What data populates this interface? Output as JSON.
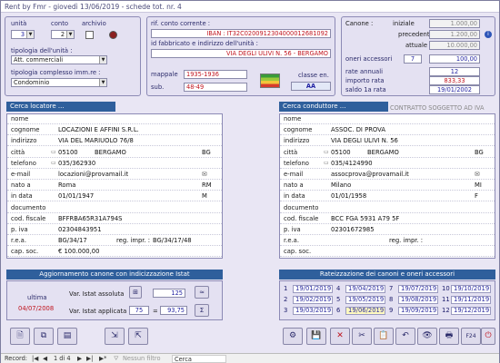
{
  "window": {
    "title": "Rent by Fmr - giovedì 13/06/2019 - schede tot. nr. 4"
  },
  "unit": {
    "unita_label": "unità",
    "conto_label": "conto",
    "archivio_label": "archivio",
    "unita_value": "3",
    "conto_value": "2",
    "tipologia_label": "tipologia dell'unità :",
    "tipologia_value": "Att. commerciali",
    "complesso_label": "tipologia complesso imm.re :",
    "complesso_value": "Condominio"
  },
  "conto": {
    "rif_label": "rif. conto corrente :",
    "iban": "IBAN : IT32C0200912304000012681092",
    "indirizzo_label": "id fabbricato e indirizzo dell'unità :",
    "indirizzo": "VIA DEGLI ULIVI N. 56 - BERGAMO",
    "mappale_label": "mappale",
    "mappale": "1935-1936",
    "sub_label": "sub.",
    "sub": "48-49",
    "classe_label": "classe en.",
    "classe": "AA"
  },
  "canone": {
    "canone_label": "Canone :",
    "iniziale_label": "iniziale",
    "iniziale": "1.000,00",
    "precedente_label": "precedente",
    "precedente": "1.200,00",
    "attuale_label": "attuale",
    "attuale": "10.000,00",
    "oneri_label": "oneri accessori",
    "oneri_n": "7",
    "oneri": "100,00",
    "rate_label": "rate annuali",
    "rate": "12",
    "importo_label": "importo rata",
    "importo": "833,33",
    "saldo_label": "saldo 1a rata",
    "saldo": "19/01/2002",
    "contratto": "CONTRATTO SOGGETTO AD IVA"
  },
  "locatore": {
    "header": "Cerca locatore ...",
    "rows": [
      {
        "k": "nome",
        "v": ""
      },
      {
        "k": "cognome",
        "v": "LOCAZIONI E AFFINI S.R.L."
      },
      {
        "k": "indirizzo",
        "v": "VIA DEL MARIUOLO 76/8"
      },
      {
        "k": "città",
        "v": "05100",
        "v2": "BERGAMO",
        "v3": "BG"
      },
      {
        "k": "telefono",
        "v": "035/362930"
      },
      {
        "k": "e-mail",
        "v": "locazioni@provamail.it"
      },
      {
        "k": "nato a",
        "v": "Roma",
        "v3": "RM"
      },
      {
        "k": "in data",
        "v": "01/01/1947",
        "v3": "M"
      },
      {
        "k": "documento",
        "v": ""
      },
      {
        "k": "cod. fiscale",
        "v": "BFFRBA65R31A794S"
      },
      {
        "k": "p. iva",
        "v": "02304843951"
      },
      {
        "k": "r.e.a.",
        "v": "BG/34/17",
        "v2k": "reg. impr. :",
        "v2": "BG/34/17/48"
      },
      {
        "k": "cap. soc.",
        "v": "€ 100.000,00"
      }
    ]
  },
  "conduttore": {
    "header": "Cerca conduttore ...",
    "rows": [
      {
        "k": "nome",
        "v": ""
      },
      {
        "k": "cognome",
        "v": "ASSOC. DI PROVA"
      },
      {
        "k": "indirizzo",
        "v": "VIA DEGLI ULIVI N. 56"
      },
      {
        "k": "città",
        "v": "05100",
        "v2": "BERGAMO",
        "v3": "BG"
      },
      {
        "k": "telefono",
        "v": "035/4124990"
      },
      {
        "k": "e-mail",
        "v": "assocprova@provamail.it"
      },
      {
        "k": "nato a",
        "v": "Milano",
        "v3": "MI"
      },
      {
        "k": "in data",
        "v": "01/01/1958",
        "v3": "F"
      },
      {
        "k": "documento",
        "v": ""
      },
      {
        "k": "cod. fiscale",
        "v": "BCC FGA 5931 A79 5F"
      },
      {
        "k": "p. iva",
        "v": "02301672985"
      },
      {
        "k": "r.e.a.",
        "v": "",
        "v2k": "reg. impr. :",
        "v2": ""
      },
      {
        "k": "cap. soc.",
        "v": ""
      }
    ]
  },
  "istat": {
    "header": "Aggiornamento canone con indicizzazione Istat",
    "ultima_label": "ultima",
    "ultima": "04/07/2008",
    "assoluta_label": "Var. Istat assoluta",
    "assoluta": "125",
    "applicata_label": "Var. Istat applicata",
    "applicata_pct": "75",
    "applicata": "93,75"
  },
  "rate_header": "Rateizzazione dei canoni e oneri accessori",
  "rates": [
    {
      "n": "1",
      "d": "19/01/2019"
    },
    {
      "n": "4",
      "d": "19/04/2019"
    },
    {
      "n": "7",
      "d": "19/07/2019"
    },
    {
      "n": "10",
      "d": "19/10/2019"
    },
    {
      "n": "2",
      "d": "19/02/2019"
    },
    {
      "n": "5",
      "d": "19/05/2019"
    },
    {
      "n": "8",
      "d": "19/08/2019"
    },
    {
      "n": "11",
      "d": "19/11/2019"
    },
    {
      "n": "3",
      "d": "19/03/2019"
    },
    {
      "n": "6",
      "d": "19/06/2019"
    },
    {
      "n": "9",
      "d": "19/09/2019"
    },
    {
      "n": "12",
      "d": "19/12/2019"
    }
  ],
  "status": {
    "record_label": "Record:",
    "record": "1 di 4",
    "filter": "Nessun filtro",
    "search": "Cerca"
  }
}
